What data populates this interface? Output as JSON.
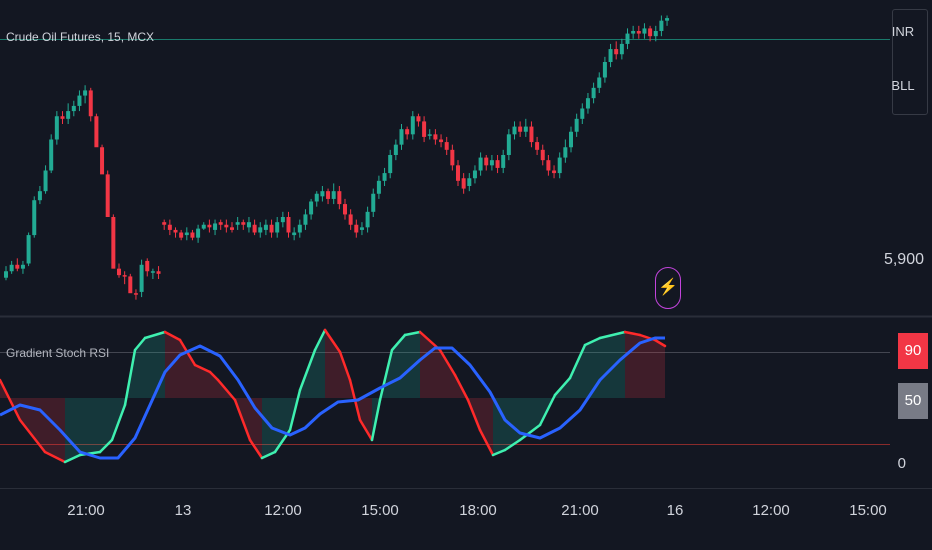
{
  "header": {
    "ticker_label": "Crude Oil Futures, 15, MCX"
  },
  "currency_panel": {
    "currency": "INR",
    "unit": "BLL"
  },
  "price_scale": {
    "label": "5,900"
  },
  "indicator": {
    "title": "Gradient Stoch RSI",
    "level_upper_label": "90",
    "level_mid_label": "50",
    "level_zero_label": "0"
  },
  "time_axis": {
    "labels": [
      "21:00",
      "13",
      "12:00",
      "15:00",
      "18:00",
      "21:00",
      "16",
      "12:00",
      "15:00"
    ]
  },
  "event_icon": "flash-icon",
  "colors": {
    "background": "#131722",
    "bull": "#22ab94",
    "bear": "#f23645",
    "stoch_up": "#3ff0b0",
    "stoch_down": "#ff2a2a",
    "signal": "#2962ff",
    "upper_badge": "#f23645",
    "mid_badge": "#787b86"
  },
  "chart_data": {
    "type": "candlestick",
    "candles": [
      [
        145,
        150,
        143,
        154
      ],
      [
        150,
        155,
        148,
        158
      ],
      [
        155,
        152,
        150,
        160
      ],
      [
        152,
        155,
        148,
        158
      ],
      [
        156,
        178,
        154,
        180
      ],
      [
        178,
        205,
        176,
        208
      ],
      [
        205,
        212,
        202,
        216
      ],
      [
        212,
        228,
        210,
        232
      ],
      [
        228,
        252,
        226,
        256
      ],
      [
        252,
        270,
        248,
        274
      ],
      [
        270,
        268,
        264,
        274
      ],
      [
        268,
        274,
        264,
        280
      ],
      [
        274,
        278,
        270,
        282
      ],
      [
        278,
        286,
        274,
        290
      ],
      [
        286,
        290,
        280,
        294
      ],
      [
        290,
        270,
        266,
        292
      ],
      [
        270,
        246,
        266,
        272
      ],
      [
        246,
        225,
        240,
        248
      ],
      [
        225,
        192,
        222,
        228
      ],
      [
        192,
        152,
        188,
        194
      ],
      [
        152,
        147,
        145,
        156
      ],
      [
        147,
        146,
        140,
        150
      ],
      [
        146,
        133,
        140,
        148
      ],
      [
        133,
        132,
        128,
        136
      ],
      [
        134,
        155,
        130,
        159
      ],
      [
        158,
        150,
        146,
        160
      ],
      [
        150,
        150,
        144,
        152
      ],
      [
        150,
        148,
        144,
        154
      ],
      [
        188,
        186,
        182,
        190
      ],
      [
        186,
        182,
        178,
        190
      ],
      [
        182,
        180,
        176,
        184
      ],
      [
        180,
        176,
        174,
        182
      ],
      [
        178,
        180,
        174,
        184
      ],
      [
        180,
        176,
        174,
        182
      ],
      [
        176,
        183,
        172,
        186
      ],
      [
        183,
        186,
        182,
        188
      ],
      [
        186,
        184,
        180,
        190
      ],
      [
        182,
        187,
        178,
        190
      ],
      [
        188,
        186,
        182,
        190
      ],
      [
        186,
        184,
        180,
        190
      ],
      [
        184,
        182,
        180,
        188
      ],
      [
        186,
        188,
        182,
        192
      ],
      [
        188,
        186,
        182,
        190
      ],
      [
        184,
        188,
        180,
        192
      ],
      [
        186,
        180,
        178,
        190
      ],
      [
        180,
        184,
        176,
        188
      ],
      [
        182,
        186,
        178,
        190
      ],
      [
        186,
        180,
        176,
        190
      ],
      [
        180,
        188,
        176,
        192
      ],
      [
        188,
        192,
        184,
        196
      ],
      [
        192,
        180,
        176,
        196
      ],
      [
        178,
        180,
        174,
        184
      ],
      [
        180,
        186,
        176,
        190
      ],
      [
        186,
        194,
        182,
        198
      ],
      [
        194,
        204,
        190,
        206
      ],
      [
        204,
        210,
        200,
        212
      ],
      [
        208,
        212,
        204,
        216
      ],
      [
        212,
        206,
        202,
        214
      ],
      [
        206,
        212,
        202,
        218
      ],
      [
        212,
        202,
        198,
        216
      ],
      [
        202,
        194,
        190,
        206
      ],
      [
        194,
        186,
        182,
        198
      ],
      [
        186,
        180,
        176,
        190
      ],
      [
        182,
        184,
        178,
        188
      ],
      [
        184,
        196,
        180,
        200
      ],
      [
        196,
        210,
        192,
        214
      ],
      [
        210,
        220,
        206,
        224
      ],
      [
        220,
        226,
        216,
        230
      ],
      [
        226,
        240,
        222,
        244
      ],
      [
        240,
        248,
        236,
        252
      ],
      [
        248,
        260,
        244,
        264
      ],
      [
        260,
        256,
        252,
        262
      ],
      [
        256,
        270,
        252,
        274
      ],
      [
        270,
        266,
        262,
        272
      ],
      [
        266,
        254,
        250,
        270
      ],
      [
        256,
        256,
        252,
        260
      ],
      [
        256,
        252,
        248,
        260
      ],
      [
        252,
        250,
        246,
        256
      ],
      [
        250,
        244,
        240,
        254
      ],
      [
        244,
        232,
        228,
        248
      ],
      [
        232,
        220,
        216,
        236
      ],
      [
        222,
        214,
        210,
        226
      ],
      [
        216,
        222,
        212,
        226
      ],
      [
        222,
        228,
        218,
        232
      ],
      [
        228,
        238,
        224,
        242
      ],
      [
        238,
        232,
        228,
        240
      ],
      [
        232,
        236,
        228,
        240
      ],
      [
        236,
        230,
        226,
        240
      ],
      [
        230,
        240,
        226,
        244
      ],
      [
        240,
        256,
        236,
        260
      ],
      [
        256,
        262,
        252,
        266
      ],
      [
        262,
        258,
        254,
        266
      ],
      [
        258,
        262,
        254,
        268
      ],
      [
        262,
        250,
        246,
        266
      ],
      [
        250,
        244,
        240,
        254
      ],
      [
        244,
        236,
        232,
        248
      ],
      [
        236,
        228,
        224,
        240
      ],
      [
        228,
        226,
        222,
        232
      ],
      [
        226,
        238,
        222,
        242
      ],
      [
        238,
        246,
        234,
        252
      ],
      [
        246,
        258,
        242,
        262
      ],
      [
        258,
        268,
        254,
        272
      ],
      [
        268,
        276,
        264,
        280
      ],
      [
        276,
        284,
        272,
        288
      ],
      [
        284,
        292,
        280,
        296
      ],
      [
        292,
        300,
        288,
        304
      ],
      [
        300,
        312,
        296,
        316
      ],
      [
        312,
        322,
        308,
        326
      ],
      [
        322,
        318,
        314,
        328
      ],
      [
        318,
        326,
        314,
        330
      ],
      [
        326,
        334,
        322,
        338
      ],
      [
        334,
        336,
        330,
        340
      ],
      [
        336,
        334,
        330,
        340
      ],
      [
        334,
        338,
        330,
        342
      ],
      [
        338,
        332,
        328,
        340
      ],
      [
        332,
        336,
        328,
        340
      ],
      [
        336,
        344,
        332,
        348
      ],
      [
        344,
        346,
        340,
        348
      ]
    ]
  }
}
